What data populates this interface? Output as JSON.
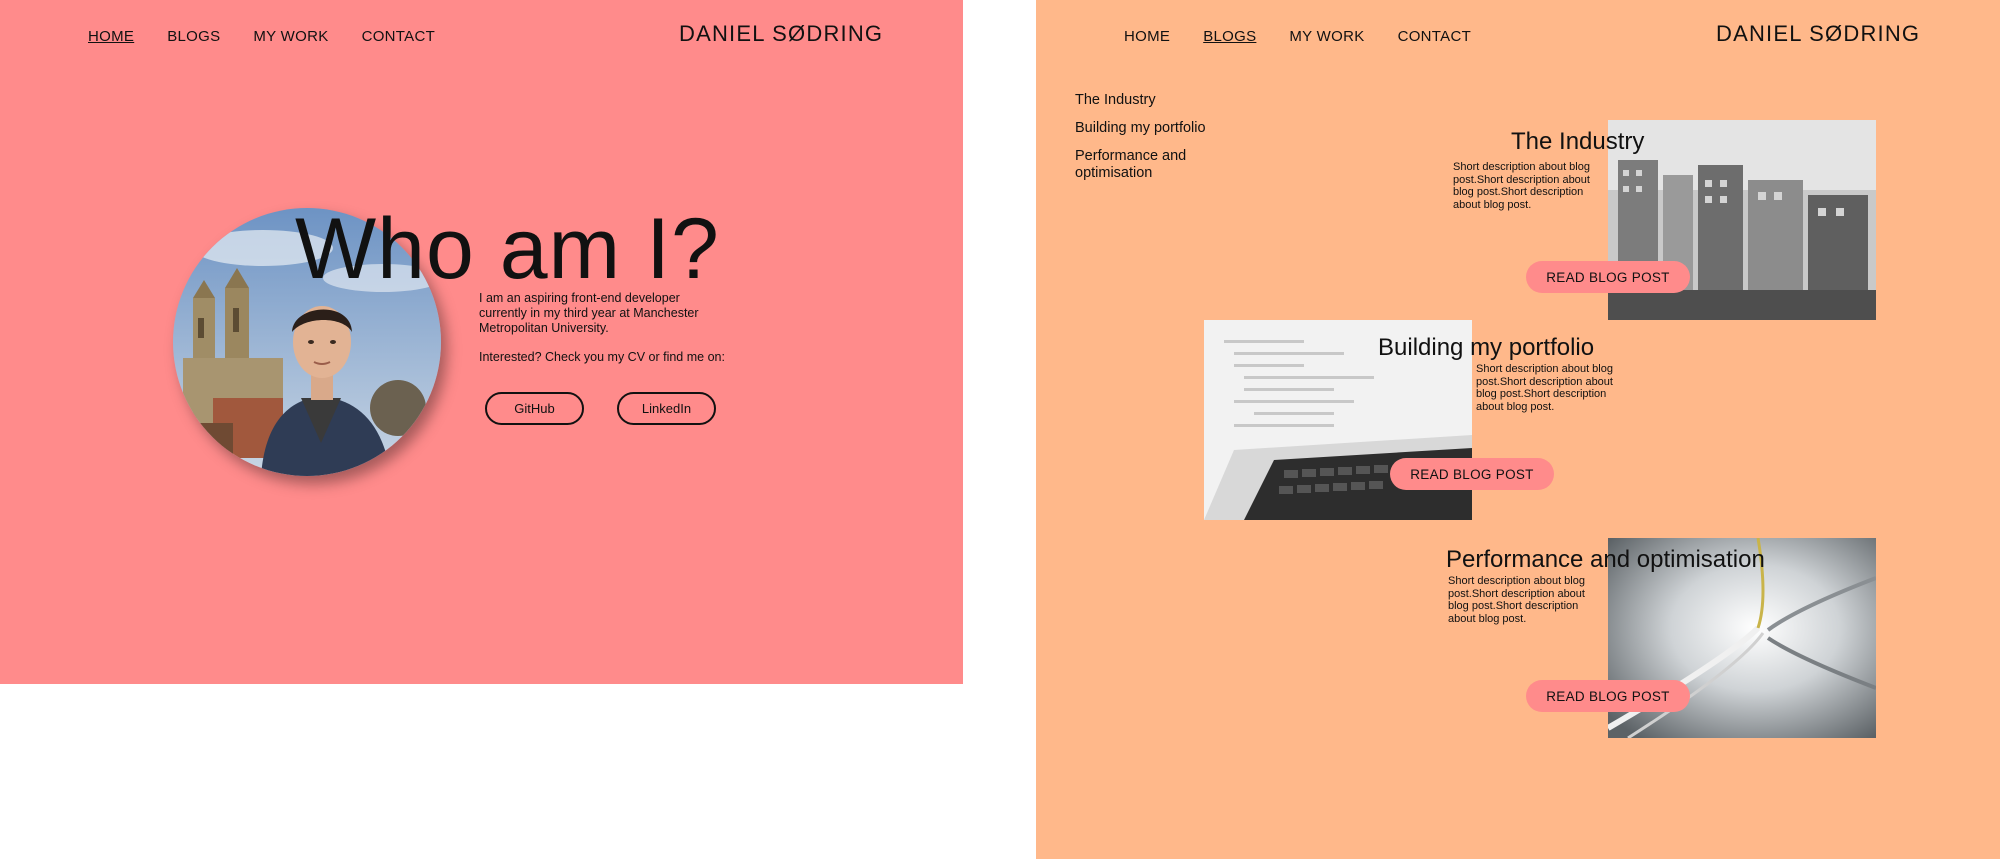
{
  "home": {
    "nav": [
      "HOME",
      "BLOGS",
      "MY WORK",
      "CONTACT"
    ],
    "brand": "DANIEL SØDRING",
    "hero_title": "Who am I?",
    "intro": "I am an aspiring front-end developer currently in my third year at Manchester Metropolitan University.",
    "intro_cta": "Interested? Check you my CV or find me on:",
    "github_label": "GitHub",
    "linkedin_label": "LinkedIn"
  },
  "blogs": {
    "nav": [
      "HOME",
      "BLOGS",
      "MY WORK",
      "CONTACT"
    ],
    "brand": "DANIEL SØDRING",
    "toc": [
      "The Industry",
      "Building my portfolio",
      "Performance and optimisation"
    ],
    "posts": [
      {
        "title": "The Industry",
        "description": "Short description about blog post.Short description about blog post.Short description about blog post.",
        "button": "READ BLOG POST"
      },
      {
        "title": "Building my portfolio",
        "description": "Short description about blog post.Short description about blog post.Short description about blog post.",
        "button": "READ BLOG POST"
      },
      {
        "title": "Performance and optimisation",
        "description": "Short description about blog post.Short description about blog post.Short description about blog post.",
        "button": "READ BLOG POST"
      }
    ]
  },
  "colors": {
    "home_bg": "#ff8b8b",
    "blogs_bg": "#ffb88a",
    "button_bg": "#ff8b8b"
  }
}
